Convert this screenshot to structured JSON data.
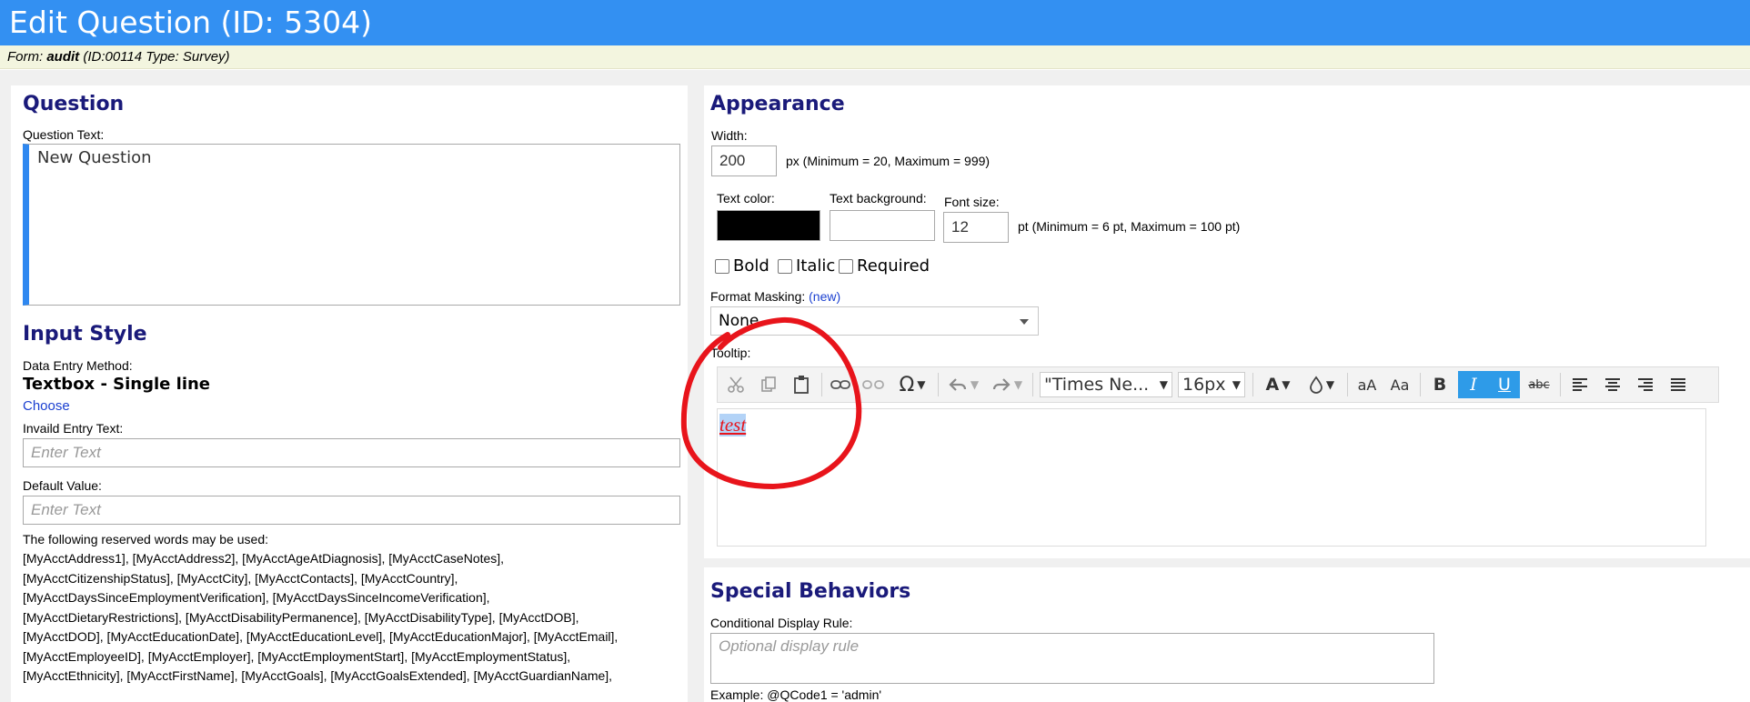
{
  "header": {
    "title": "Edit Question (ID: 5304)"
  },
  "formbar": {
    "form_label": "Form:",
    "form_name": "audit",
    "form_meta": "(ID:00114  Type: Survey)"
  },
  "question": {
    "heading": "Question",
    "text_label": "Question Text:",
    "text_value": "New Question"
  },
  "input_style": {
    "heading": "Input Style",
    "method_label": "Data Entry Method:",
    "method_value": "Textbox - Single line",
    "choose_link": "Choose",
    "invalid_label": "Invaild Entry Text:",
    "invalid_placeholder": "Enter Text",
    "default_label": "Default Value:",
    "default_placeholder": "Enter Text",
    "reserved_intro": "The following reserved words may be used:",
    "reserved_lines": [
      "[MyAcctAddress1], [MyAcctAddress2], [MyAcctAgeAtDiagnosis], [MyAcctCaseNotes],",
      "[MyAcctCitizenshipStatus], [MyAcctCity], [MyAcctContacts], [MyAcctCountry],",
      "[MyAcctDaysSinceEmploymentVerification], [MyAcctDaysSinceIncomeVerification],",
      "[MyAcctDietaryRestrictions], [MyAcctDisabilityPermanence], [MyAcctDisabilityType], [MyAcctDOB],",
      "[MyAcctDOD], [MyAcctEducationDate], [MyAcctEducationLevel], [MyAcctEducationMajor], [MyAcctEmail],",
      "[MyAcctEmployeeID], [MyAcctEmployer], [MyAcctEmploymentStart], [MyAcctEmploymentStatus],",
      "[MyAcctEthnicity], [MyAcctFirstName], [MyAcctGoals], [MyAcctGoalsExtended], [MyAcctGuardianName],"
    ]
  },
  "appearance": {
    "heading": "Appearance",
    "width_label": "Width:",
    "width_value": "200",
    "width_hint": "px (Minimum = 20, Maximum = 999)",
    "text_color_label": "Text color:",
    "text_color_value": "#000000",
    "text_bg_label": "Text background:",
    "font_size_label": "Font size:",
    "font_size_value": "12",
    "font_size_hint": "pt (Minimum = 6 pt, Maximum = 100 pt)",
    "bold_label": "Bold",
    "italic_label": "Italic",
    "required_label": "Required",
    "masking_label": "Format Masking:",
    "masking_new": "(new)",
    "masking_value": "None",
    "tooltip_label": "Tooltip:",
    "toolbar": {
      "omega": "Ω",
      "font_family": "\"Times Ne...",
      "font_size": "16px",
      "font_color": "A",
      "size_a1": "aA",
      "size_a2": "Aa",
      "bold": "B",
      "italic": "I",
      "underline": "U",
      "strike": "abc"
    },
    "tooltip_text": "test"
  },
  "special": {
    "heading": "Special Behaviors",
    "rule_label": "Conditional Display Rule:",
    "rule_placeholder": "Optional display rule",
    "example": "Example: @QCode1 = 'admin'"
  },
  "colors": {
    "header_bg": "#3390f2",
    "accent": "#2f88f0",
    "heading": "#1a1a7a",
    "active_tool": "#2e9be8",
    "annotation": "#e8141b"
  }
}
